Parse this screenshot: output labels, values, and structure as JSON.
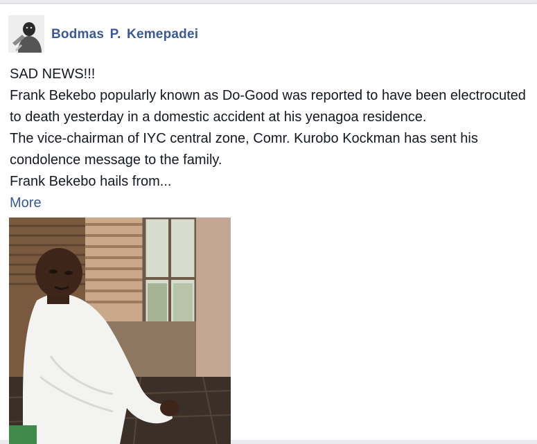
{
  "post": {
    "author": "Bodmas P.  Kemepadei",
    "lines": [
      "SAD NEWS!!!",
      "Frank Bekebo popularly known as Do-Good  was reported to have been electrocuted",
      "to death yesterday in a domestic accident at his yenagoa residence.",
      "The vice-chairman of IYC central zone, Comr. Kurobo Kockman has sent his",
      "condolence message to the family.",
      "Frank Bekebo hails from..."
    ],
    "more_label": "More"
  },
  "colors": {
    "author": "#3b5998",
    "link": "#365899",
    "text": "#141823",
    "background": "#ffffff"
  },
  "icons": {
    "avatar": "profile-avatar",
    "photo": "post-photo"
  }
}
